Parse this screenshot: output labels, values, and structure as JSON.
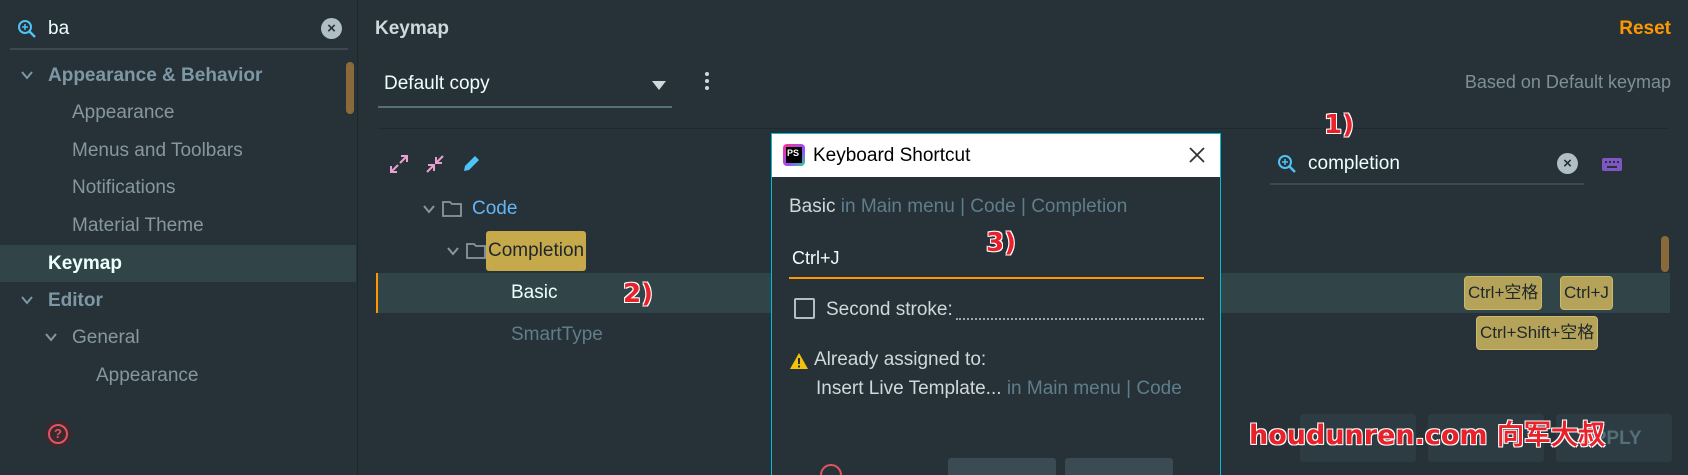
{
  "left_search": {
    "value": "ba"
  },
  "tree": [
    {
      "label": "Appearance & Behavior"
    },
    {
      "label": "Appearance"
    },
    {
      "label": "Menus and Toolbars"
    },
    {
      "label": "Notifications"
    },
    {
      "label": "Material Theme"
    },
    {
      "label": "Keymap"
    },
    {
      "label": "Editor"
    },
    {
      "label": "General"
    },
    {
      "label": "Appearance"
    }
  ],
  "keymap": {
    "title": "Keymap",
    "reset_label": "Reset",
    "scheme_value": "Default copy",
    "based_on": "Based on Default keymap",
    "search_value": "completion",
    "rows": {
      "code": "Code",
      "completion": "Completion",
      "basic": "Basic",
      "smarttype": "SmartType"
    },
    "shortcuts": {
      "basic_1": "Ctrl+空格",
      "basic_2": "Ctrl+J",
      "smarttype_1": "Ctrl+Shift+空格"
    },
    "apply_label": "APPLY"
  },
  "dialog": {
    "title": "Keyboard Shortcut",
    "action_name": "Basic",
    "action_path": "in Main menu | Code | Completion",
    "shortcut_value": "Ctrl+J",
    "second_stroke_label": "Second stroke:",
    "warning_label": "Already assigned to:",
    "assigned_name": "Insert Live Template...",
    "assigned_path": "in Main menu | Code"
  },
  "annotations": {
    "a1": "1)",
    "a2": "2)",
    "a3": "3)",
    "watermark": "houdunren.com 向军大叔"
  },
  "colors": {
    "accent": "#ff9800",
    "highlight": "#c5a94b",
    "dialog_border": "#00bcd4",
    "annotation": "#e8212a"
  }
}
